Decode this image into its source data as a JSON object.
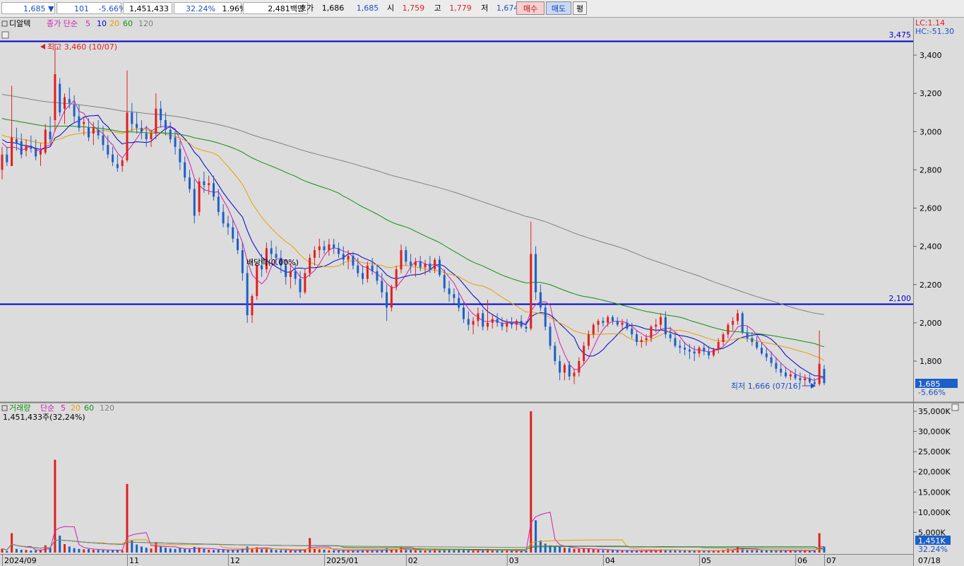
{
  "topbar": {
    "price": "1,685",
    "change_arrow": "▼",
    "change": "101",
    "change_pct": "-5.66%",
    "volume": "1,451,433",
    "volume_ratio": "32.24%",
    "turnover": "1.96%",
    "trade_value": "2,481백만",
    "quote_label": "호가",
    "ask": "1,686",
    "bid": "1,685",
    "open_label": "시",
    "open": "1,759",
    "high_label": "고",
    "high": "1,779",
    "low_label": "저",
    "low": "1,674",
    "buy_label": "매수",
    "sell_label": "매도",
    "eval_label": "평"
  },
  "price_panel": {
    "indicator_name": "디알텍",
    "ma_label": "종가 단순",
    "ma_periods": [
      "5",
      "10",
      "20",
      "60",
      "120"
    ],
    "lc_label": "LC:1.14",
    "hc_label": "HC:-51.30",
    "high_marker": "최고 3,460 (10/07)",
    "low_marker": "최저 1,666 (07/16)",
    "dividend_label": "배당락(0.00%)",
    "hline_upper": "3,475",
    "hline_lower": "2,100",
    "last_price": "1,685",
    "last_change": "-5.66%"
  },
  "volume_panel": {
    "label": "거래량",
    "ma_label": "단순",
    "ma_periods": [
      "5",
      "20",
      "60",
      "120"
    ],
    "current": "1,451,433주(32,24%)",
    "last_volume": "1,451K",
    "last_ratio": "32.24%"
  },
  "colors": {
    "up": "#e0201e",
    "down": "#1c5fc8",
    "ma5": "#d020b0",
    "ma10": "#0000cc",
    "ma20": "#e8a000",
    "ma60": "#109010",
    "ma120": "#808080",
    "hline": "#0000d0",
    "panel_bg": "#dcdcdc"
  },
  "chart_data": {
    "type": "candlestick",
    "price_axis": {
      "ticks": [
        "3,400",
        "3,200",
        "3,000",
        "2,800",
        "2,600",
        "2,400",
        "2,200",
        "2,000",
        "1,800"
      ],
      "ylim": [
        1640,
        3560
      ]
    },
    "volume_axis": {
      "ticks": [
        "35,000K",
        "30,000K",
        "25,000K",
        "20,000K",
        "15,000K",
        "10,000K",
        "5,000K"
      ],
      "ylim": [
        0,
        37000
      ]
    },
    "x_labels": [
      "2024/09",
      "11",
      "12",
      "2025/01",
      "02",
      "03",
      "04",
      "05",
      "06",
      "07",
      "07/18"
    ],
    "hlines": [
      3475,
      2100
    ],
    "candles": [
      [
        2800,
        2920,
        2750,
        2880,
        950
      ],
      [
        2880,
        2920,
        2820,
        2840,
        420
      ],
      [
        2820,
        3240,
        2820,
        2970,
        4800
      ],
      [
        2960,
        3020,
        2900,
        2940,
        900
      ],
      [
        2950,
        2990,
        2860,
        2880,
        700
      ],
      [
        2900,
        2960,
        2870,
        2930,
        650
      ],
      [
        2920,
        2980,
        2890,
        2910,
        500
      ],
      [
        2910,
        2960,
        2850,
        2870,
        550
      ],
      [
        2880,
        2940,
        2820,
        2900,
        620
      ],
      [
        2890,
        3040,
        2880,
        3010,
        1800
      ],
      [
        3000,
        3080,
        2940,
        2960,
        1200
      ],
      [
        3060,
        3460,
        3000,
        3300,
        23000
      ],
      [
        3250,
        3280,
        3080,
        3100,
        4200
      ],
      [
        3120,
        3200,
        3040,
        3180,
        2100
      ],
      [
        3170,
        3230,
        3120,
        3150,
        1500
      ],
      [
        3140,
        3190,
        3050,
        3080,
        1100
      ],
      [
        3080,
        3140,
        3000,
        3020,
        900
      ],
      [
        3040,
        3080,
        2980,
        3050,
        800
      ],
      [
        3020,
        3070,
        2950,
        2970,
        850
      ],
      [
        2990,
        3050,
        2930,
        3020,
        700
      ],
      [
        3010,
        3060,
        2960,
        2980,
        650
      ],
      [
        2980,
        3030,
        2900,
        2930,
        600
      ],
      [
        2930,
        2980,
        2860,
        2880,
        550
      ],
      [
        2880,
        2920,
        2820,
        2840,
        600
      ],
      [
        2830,
        2880,
        2790,
        2810,
        700
      ],
      [
        2820,
        2860,
        2790,
        2850,
        500
      ],
      [
        2850,
        3320,
        2840,
        3100,
        17000
      ],
      [
        3100,
        3150,
        3000,
        3040,
        3000
      ],
      [
        3040,
        3100,
        2990,
        3020,
        2000
      ],
      [
        3020,
        3060,
        2960,
        3000,
        1500
      ],
      [
        2990,
        3030,
        2920,
        2960,
        1200
      ],
      [
        2960,
        3010,
        2920,
        2990,
        1000
      ],
      [
        2990,
        3200,
        2960,
        3120,
        2600
      ],
      [
        3120,
        3160,
        3020,
        3060,
        1500
      ],
      [
        3060,
        3100,
        2980,
        3010,
        1200
      ],
      [
        3010,
        3050,
        2940,
        2960,
        1000
      ],
      [
        2970,
        3010,
        2880,
        2920,
        900
      ],
      [
        2910,
        2950,
        2800,
        2840,
        1100
      ],
      [
        2840,
        2870,
        2740,
        2760,
        900
      ],
      [
        2760,
        2800,
        2680,
        2700,
        800
      ],
      [
        2700,
        2750,
        2520,
        2560,
        1400
      ],
      [
        2580,
        2760,
        2560,
        2740,
        1200
      ],
      [
        2740,
        2790,
        2680,
        2720,
        900
      ],
      [
        2720,
        2770,
        2670,
        2730,
        700
      ],
      [
        2730,
        2770,
        2640,
        2660,
        650
      ],
      [
        2660,
        2700,
        2560,
        2580,
        700
      ],
      [
        2580,
        2620,
        2500,
        2520,
        800
      ],
      [
        2520,
        2560,
        2460,
        2500,
        600
      ],
      [
        2500,
        2540,
        2420,
        2440,
        650
      ],
      [
        2440,
        2480,
        2360,
        2380,
        700
      ],
      [
        2380,
        2420,
        2220,
        2260,
        900
      ],
      [
        2260,
        2300,
        2000,
        2040,
        1500
      ],
      [
        2040,
        2150,
        2000,
        2140,
        1100
      ],
      [
        2140,
        2320,
        2120,
        2300,
        1300
      ],
      [
        2300,
        2360,
        2240,
        2280,
        900
      ],
      [
        2280,
        2420,
        2260,
        2390,
        1000
      ],
      [
        2390,
        2430,
        2330,
        2360,
        800
      ],
      [
        2360,
        2400,
        2300,
        2340,
        650
      ],
      [
        2340,
        2380,
        2260,
        2300,
        600
      ],
      [
        2300,
        2330,
        2200,
        2240,
        600
      ],
      [
        2240,
        2300,
        2180,
        2270,
        550
      ],
      [
        2270,
        2310,
        2200,
        2230,
        500
      ],
      [
        2230,
        2270,
        2130,
        2160,
        700
      ],
      [
        2160,
        2280,
        2150,
        2260,
        800
      ],
      [
        2260,
        2360,
        2240,
        2340,
        3600
      ],
      [
        2340,
        2400,
        2300,
        2380,
        1000
      ],
      [
        2380,
        2440,
        2340,
        2400,
        800
      ],
      [
        2400,
        2430,
        2360,
        2380,
        700
      ],
      [
        2380,
        2440,
        2350,
        2410,
        600
      ],
      [
        2410,
        2440,
        2360,
        2390,
        550
      ],
      [
        2390,
        2420,
        2340,
        2360,
        500
      ],
      [
        2360,
        2400,
        2300,
        2330,
        550
      ],
      [
        2330,
        2380,
        2280,
        2350,
        500
      ],
      [
        2350,
        2370,
        2280,
        2300,
        500
      ],
      [
        2300,
        2340,
        2240,
        2260,
        600
      ],
      [
        2260,
        2300,
        2200,
        2230,
        600
      ],
      [
        2230,
        2320,
        2210,
        2300,
        550
      ],
      [
        2300,
        2340,
        2250,
        2270,
        500
      ],
      [
        2270,
        2300,
        2200,
        2220,
        550
      ],
      [
        2220,
        2260,
        2130,
        2160,
        600
      ],
      [
        2160,
        2200,
        2010,
        2080,
        1000
      ],
      [
        2080,
        2200,
        2060,
        2190,
        800
      ],
      [
        2190,
        2300,
        2170,
        2280,
        900
      ],
      [
        2280,
        2410,
        2260,
        2380,
        1200
      ],
      [
        2380,
        2400,
        2300,
        2320,
        800
      ],
      [
        2320,
        2360,
        2260,
        2300,
        700
      ],
      [
        2300,
        2340,
        2240,
        2320,
        600
      ],
      [
        2320,
        2350,
        2270,
        2290,
        550
      ],
      [
        2290,
        2330,
        2250,
        2310,
        500
      ],
      [
        2310,
        2350,
        2260,
        2280,
        500
      ],
      [
        2280,
        2340,
        2260,
        2330,
        800
      ],
      [
        2330,
        2350,
        2240,
        2250,
        700
      ],
      [
        2250,
        2280,
        2160,
        2180,
        800
      ],
      [
        2180,
        2220,
        2110,
        2150,
        700
      ],
      [
        2150,
        2180,
        2100,
        2130,
        600
      ],
      [
        2130,
        2160,
        2060,
        2080,
        650
      ],
      [
        2080,
        2110,
        2000,
        2020,
        700
      ],
      [
        2020,
        2060,
        1960,
        1990,
        600
      ],
      [
        1990,
        2030,
        1940,
        2010,
        500
      ],
      [
        2010,
        2080,
        1980,
        2050,
        550
      ],
      [
        2050,
        2070,
        1960,
        1980,
        500
      ],
      [
        1980,
        2120,
        1960,
        2000,
        900
      ],
      [
        2000,
        2040,
        1970,
        2020,
        500
      ],
      [
        2020,
        2050,
        1980,
        2000,
        500
      ],
      [
        2000,
        2030,
        1960,
        1980,
        450
      ],
      [
        1980,
        2020,
        1950,
        2000,
        450
      ],
      [
        2000,
        2030,
        1970,
        1990,
        450
      ],
      [
        1990,
        2020,
        1960,
        2010,
        500
      ],
      [
        2010,
        2040,
        1970,
        1980,
        450
      ],
      [
        1980,
        2010,
        1950,
        1970,
        450
      ],
      [
        1970,
        2530,
        1960,
        2360,
        35000
      ],
      [
        2360,
        2400,
        2120,
        2160,
        8000
      ],
      [
        2160,
        2200,
        2060,
        2080,
        3000
      ],
      [
        2080,
        2100,
        1960,
        1980,
        2200
      ],
      [
        1980,
        2000,
        1860,
        1880,
        1800
      ],
      [
        1880,
        1900,
        1780,
        1800,
        1500
      ],
      [
        1800,
        1830,
        1700,
        1740,
        1400
      ],
      [
        1740,
        1790,
        1700,
        1780,
        1200
      ],
      [
        1780,
        1800,
        1700,
        1720,
        1100
      ],
      [
        1720,
        1760,
        1680,
        1740,
        900
      ],
      [
        1740,
        1820,
        1720,
        1800,
        900
      ],
      [
        1800,
        1900,
        1780,
        1880,
        1000
      ],
      [
        1880,
        1960,
        1860,
        1940,
        900
      ],
      [
        1940,
        2000,
        1920,
        1990,
        800
      ],
      [
        1990,
        2020,
        1950,
        2010,
        700
      ],
      [
        2010,
        2030,
        1980,
        2000,
        600
      ],
      [
        2000,
        2040,
        1980,
        2030,
        600
      ],
      [
        2030,
        2040,
        1990,
        2010,
        550
      ],
      [
        2010,
        2030,
        1980,
        1990,
        500
      ],
      [
        1990,
        2020,
        1960,
        2000,
        500
      ],
      [
        2000,
        2020,
        1960,
        1970,
        450
      ],
      [
        1970,
        2000,
        1920,
        1940,
        500
      ],
      [
        1940,
        1960,
        1880,
        1900,
        500
      ],
      [
        1900,
        1930,
        1870,
        1910,
        450
      ],
      [
        1910,
        1940,
        1880,
        1920,
        450
      ],
      [
        1920,
        1990,
        1900,
        1980,
        600
      ],
      [
        1980,
        2020,
        1950,
        1990,
        600
      ],
      [
        1990,
        2050,
        1960,
        2030,
        800
      ],
      [
        2030,
        2060,
        1920,
        1940,
        700
      ],
      [
        1940,
        1980,
        1900,
        1920,
        600
      ],
      [
        1920,
        1950,
        1870,
        1880,
        550
      ],
      [
        1880,
        1910,
        1840,
        1870,
        500
      ],
      [
        1870,
        1900,
        1830,
        1860,
        500
      ],
      [
        1860,
        1890,
        1810,
        1850,
        500
      ],
      [
        1850,
        1880,
        1800,
        1840,
        450
      ],
      [
        1840,
        1880,
        1820,
        1870,
        450
      ],
      [
        1870,
        1890,
        1830,
        1850,
        450
      ],
      [
        1850,
        1880,
        1810,
        1830,
        450
      ],
      [
        1830,
        1870,
        1820,
        1860,
        500
      ],
      [
        1860,
        1920,
        1840,
        1900,
        600
      ],
      [
        1900,
        1950,
        1880,
        1940,
        700
      ],
      [
        1940,
        2000,
        1920,
        1990,
        900
      ],
      [
        1990,
        2030,
        1960,
        2010,
        800
      ],
      [
        2010,
        2070,
        1990,
        2050,
        1500
      ],
      [
        2050,
        2060,
        1940,
        1950,
        900
      ],
      [
        1950,
        1980,
        1900,
        1920,
        700
      ],
      [
        1920,
        1950,
        1880,
        1900,
        650
      ],
      [
        1900,
        1930,
        1860,
        1870,
        600
      ],
      [
        1870,
        1900,
        1830,
        1840,
        600
      ],
      [
        1840,
        1870,
        1800,
        1820,
        550
      ],
      [
        1820,
        1850,
        1770,
        1790,
        550
      ],
      [
        1790,
        1820,
        1740,
        1760,
        500
      ],
      [
        1760,
        1790,
        1720,
        1740,
        500
      ],
      [
        1740,
        1770,
        1710,
        1720,
        480
      ],
      [
        1720,
        1750,
        1700,
        1730,
        480
      ],
      [
        1730,
        1760,
        1700,
        1710,
        470
      ],
      [
        1710,
        1740,
        1680,
        1700,
        460
      ],
      [
        1700,
        1730,
        1670,
        1710,
        450
      ],
      [
        1710,
        1740,
        1680,
        1690,
        450
      ],
      [
        1690,
        1710,
        1666,
        1680,
        500
      ],
      [
        1680,
        1960,
        1670,
        1786,
        4800
      ],
      [
        1759,
        1779,
        1674,
        1685,
        1451
      ]
    ]
  }
}
